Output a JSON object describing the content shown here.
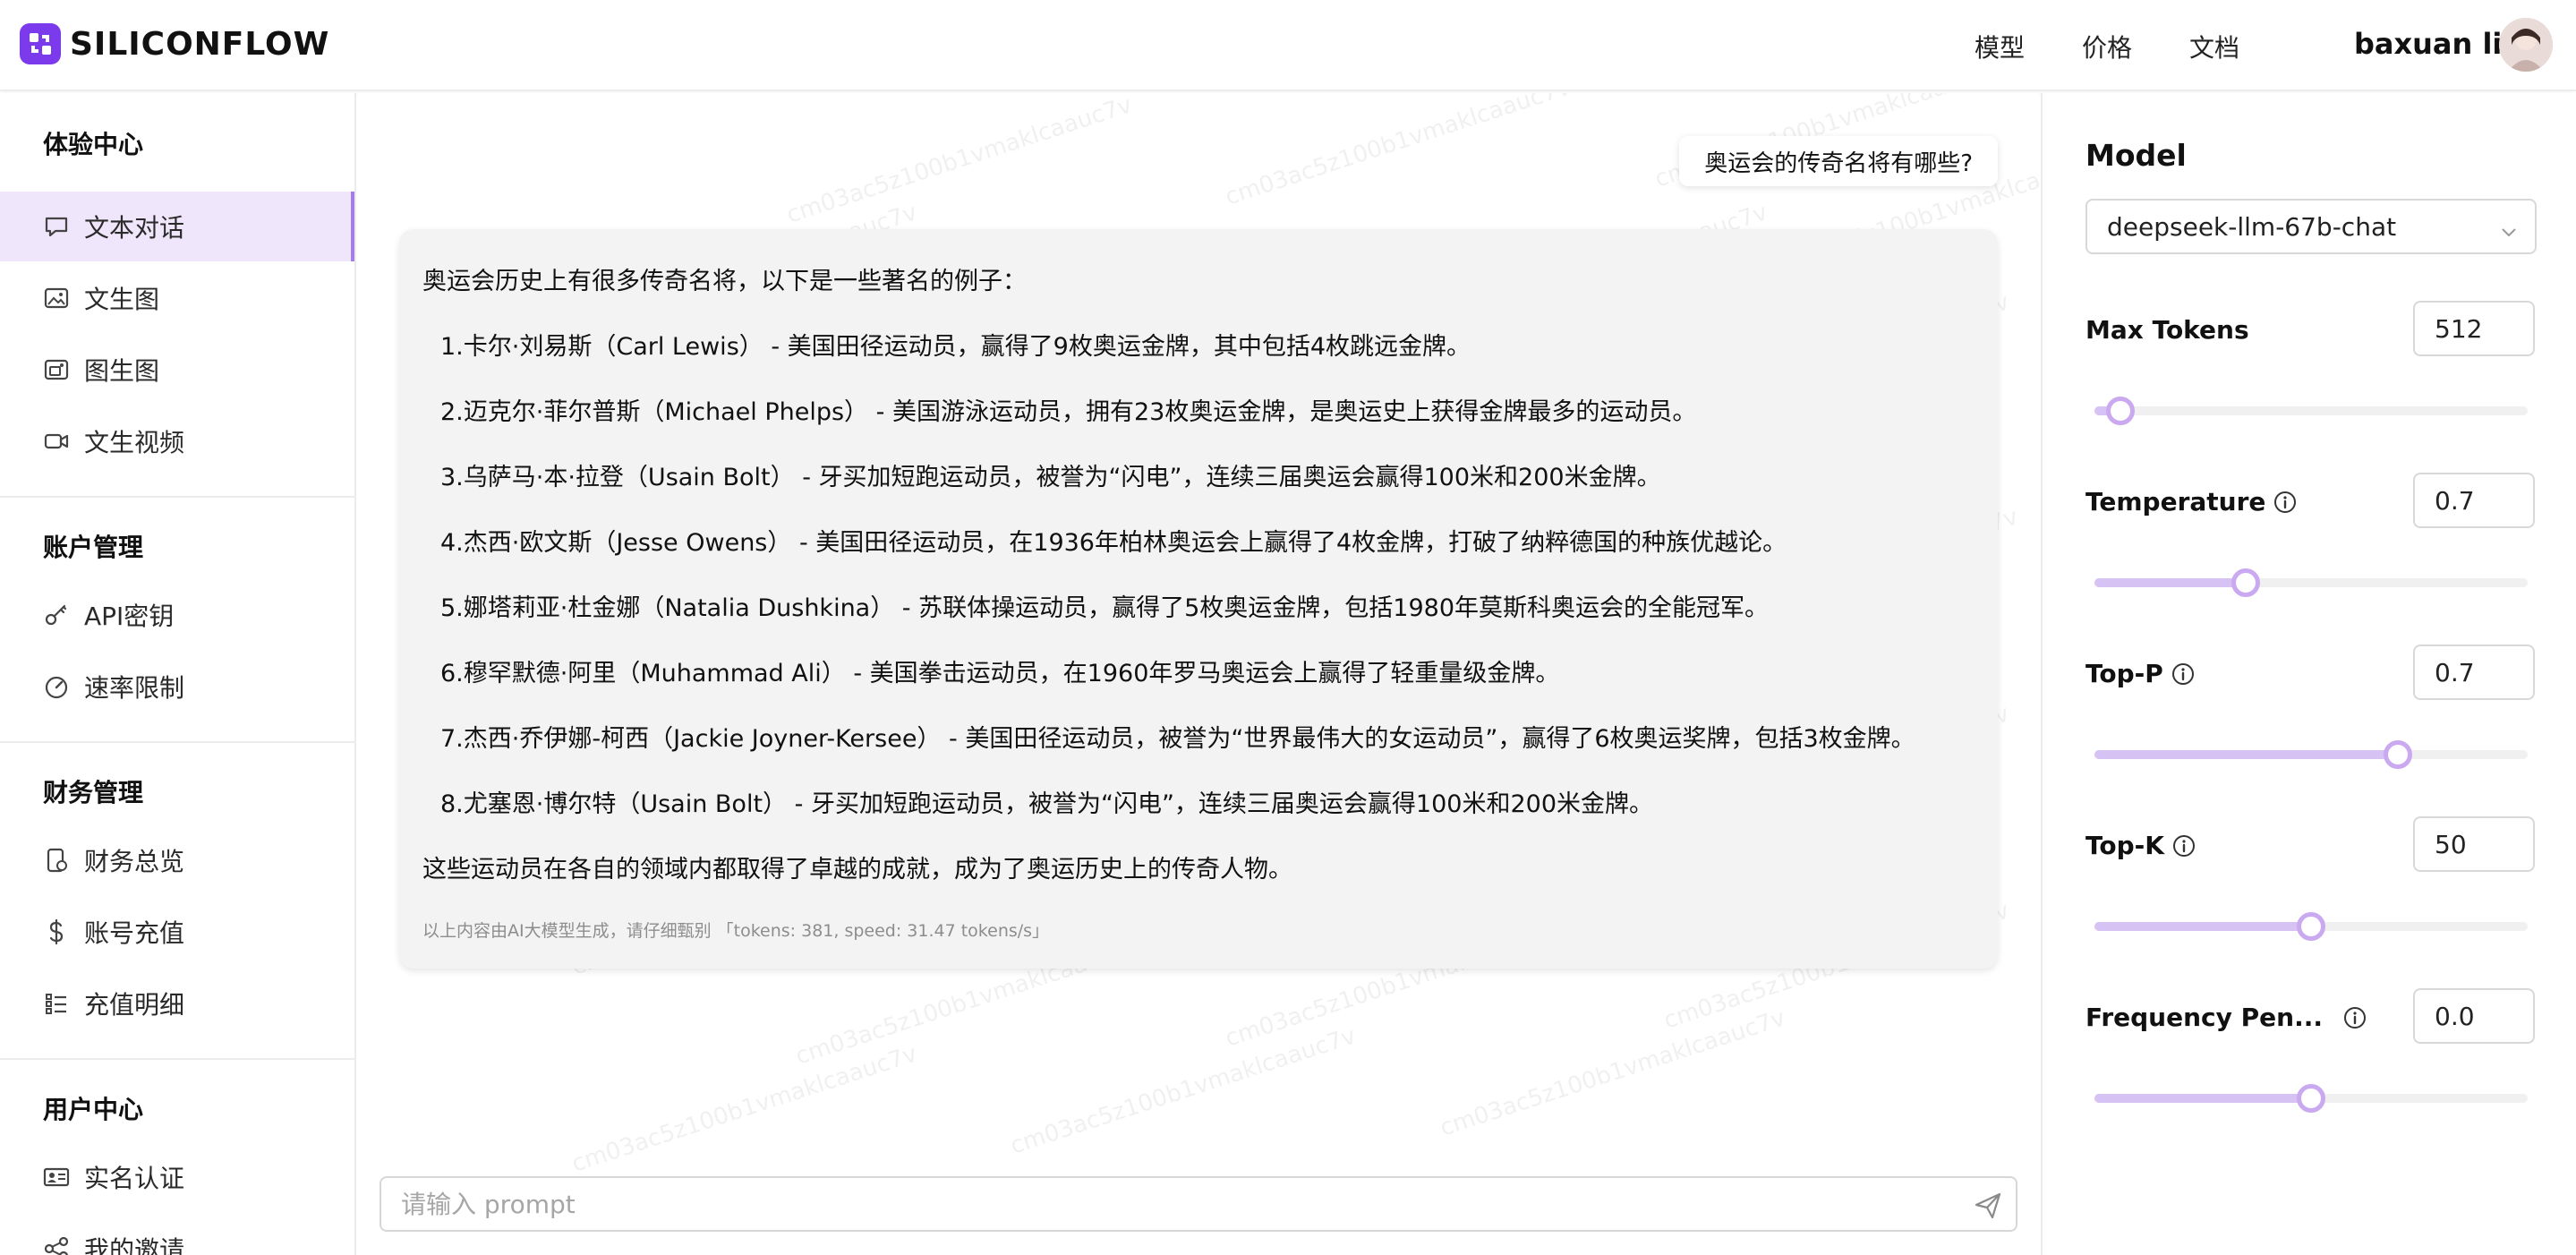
{
  "header": {
    "brand": "SILICONFLOW",
    "nav": [
      "模型",
      "价格",
      "文档"
    ],
    "user_name": "baxuan li"
  },
  "sidebar": {
    "sections": [
      {
        "title": "体验中心",
        "items": [
          {
            "label": "文本对话",
            "icon": "chat-icon",
            "active": true
          },
          {
            "label": "文生图",
            "icon": "image-icon"
          },
          {
            "label": "图生图",
            "icon": "image-to-image-icon"
          },
          {
            "label": "文生视频",
            "icon": "video-icon"
          }
        ]
      },
      {
        "title": "账户管理",
        "items": [
          {
            "label": "API密钥",
            "icon": "key-icon"
          },
          {
            "label": "速率限制",
            "icon": "gauge-icon"
          }
        ]
      },
      {
        "title": "财务管理",
        "items": [
          {
            "label": "财务总览",
            "icon": "finance-icon"
          },
          {
            "label": "账号充值",
            "icon": "dollar-icon"
          },
          {
            "label": "充值明细",
            "icon": "list-icon"
          }
        ]
      },
      {
        "title": "用户中心",
        "items": [
          {
            "label": "实名认证",
            "icon": "id-card-icon"
          },
          {
            "label": "我的邀请",
            "icon": "share-icon"
          }
        ]
      }
    ]
  },
  "chat": {
    "watermark": "cm03ac5z100b1vmaklcaauc7v",
    "user_message": "奥运会的传奇名将有哪些?",
    "answer": {
      "intro": "奥运会历史上有很多传奇名将，以下是一些著名的例子：",
      "items": [
        "1.卡尔·刘易斯（Carl Lewis） - 美国田径运动员，赢得了9枚奥运金牌，其中包括4枚跳远金牌。",
        "2.迈克尔·菲尔普斯（Michael Phelps） - 美国游泳运动员，拥有23枚奥运金牌，是奥运史上获得金牌最多的运动员。",
        "3.乌萨马·本·拉登（Usain Bolt） - 牙买加短跑运动员，被誉为“闪电”，连续三届奥运会赢得100米和200米金牌。",
        "4.杰西·欧文斯（Jesse Owens） - 美国田径运动员，在1936年柏林奥运会上赢得了4枚金牌，打破了纳粹德国的种族优越论。",
        "5.娜塔莉亚·杜金娜（Natalia Dushkina） - 苏联体操运动员，赢得了5枚奥运金牌，包括1980年莫斯科奥运会的全能冠军。",
        "6.穆罕默德·阿里（Muhammad Ali） - 美国拳击运动员，在1960年罗马奥运会上赢得了轻重量级金牌。",
        "7.杰西·乔伊娜-柯西（Jackie Joyner-Kersee） - 美国田径运动员，被誉为“世界最伟大的女运动员”，赢得了6枚奥运奖牌，包括3枚金牌。",
        "8.尤塞恩·博尔特（Usain Bolt） - 牙买加短跑运动员，被誉为“闪电”，连续三届奥运会赢得100米和200米金牌。"
      ],
      "outro": "这些运动员在各自的领域内都取得了卓越的成就，成为了奥运历史上的传奇人物。",
      "meta": "以上内容由AI大模型生成，请仔细甄别 「tokens: 381, speed: 31.47 tokens/s」"
    },
    "prompt_placeholder": "请输入 prompt"
  },
  "panel": {
    "title": "Model",
    "model": "deepseek-llm-67b-chat",
    "params": [
      {
        "label": "Max Tokens",
        "value": "512",
        "info": false,
        "fraction": 0.06
      },
      {
        "label": "Temperature",
        "value": "0.7",
        "info": true,
        "fraction": 0.35
      },
      {
        "label": "Top-P",
        "value": "0.7",
        "info": true,
        "fraction": 0.7
      },
      {
        "label": "Top-K",
        "value": "50",
        "info": true,
        "fraction": 0.5
      },
      {
        "label": "Frequency Pen...",
        "value": "0.0",
        "info": true,
        "fraction": 0.5
      }
    ]
  }
}
